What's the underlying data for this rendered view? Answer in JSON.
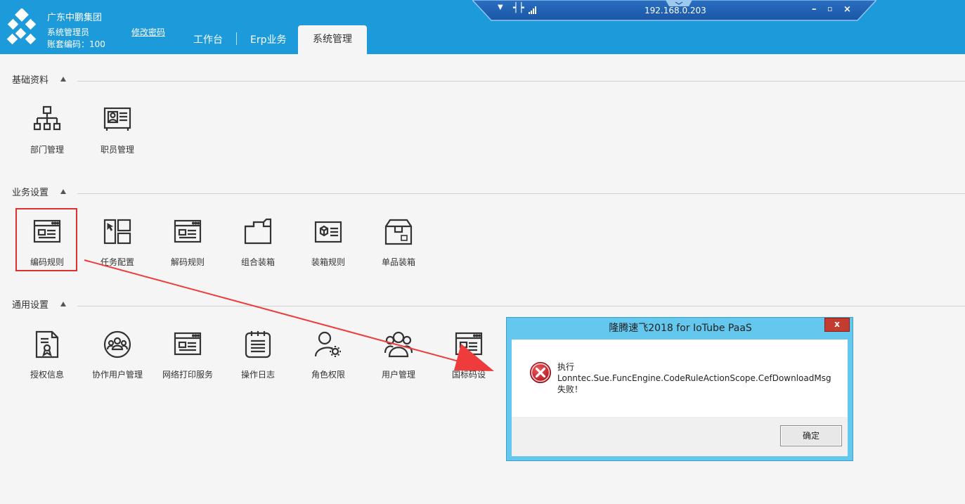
{
  "header": {
    "brand": "广东中鹏集团",
    "user": "系统管理员",
    "account": "账套编码：100",
    "change_password": "修改密码",
    "tabs": [
      {
        "label": "工作台",
        "active": false
      },
      {
        "label": "Erp业务",
        "active": false
      },
      {
        "label": "系统管理",
        "active": true
      }
    ]
  },
  "remote_bar": {
    "ip": "192.168.0.203"
  },
  "sections": [
    {
      "title": "基础资料",
      "items": [
        {
          "label": "部门管理",
          "icon": "org-chart-icon"
        },
        {
          "label": "职员管理",
          "icon": "id-card-icon"
        }
      ]
    },
    {
      "title": "业务设置",
      "items": [
        {
          "label": "编码规则",
          "icon": "browser-window-icon"
        },
        {
          "label": "任务配置",
          "icon": "layout-grid-icon"
        },
        {
          "label": "解码规则",
          "icon": "browser-window-icon"
        },
        {
          "label": "组合装箱",
          "icon": "folder-icon"
        },
        {
          "label": "装箱规则",
          "icon": "box-card-icon"
        },
        {
          "label": "单品装箱",
          "icon": "package-icon"
        }
      ]
    },
    {
      "title": "通用设置",
      "items": [
        {
          "label": "授权信息",
          "icon": "certificate-icon"
        },
        {
          "label": "协作用户管理",
          "icon": "user-group-icon"
        },
        {
          "label": "网络打印服务",
          "icon": "browser-window-icon"
        },
        {
          "label": "操作日志",
          "icon": "log-notebook-icon"
        },
        {
          "label": "角色权限",
          "icon": "user-gear-icon"
        },
        {
          "label": "用户管理",
          "icon": "users-icon"
        },
        {
          "label": "国标码设",
          "icon": "browser-window-icon"
        }
      ]
    }
  ],
  "dialog": {
    "title": "隆腾速飞2018 for IoTube PaaS",
    "close": "x",
    "message_line1": "执行",
    "message_line2": "Lonntec.Sue.FuncEngine.CodeRuleActionScope.CefDownloadMsg",
    "message_line3": "失败！",
    "ok_label": "确定"
  },
  "colors": {
    "header_bg": "#1d9ad9",
    "highlight": "#e03131",
    "dialog_frame": "#63c7ee",
    "error": "#c8102e"
  }
}
